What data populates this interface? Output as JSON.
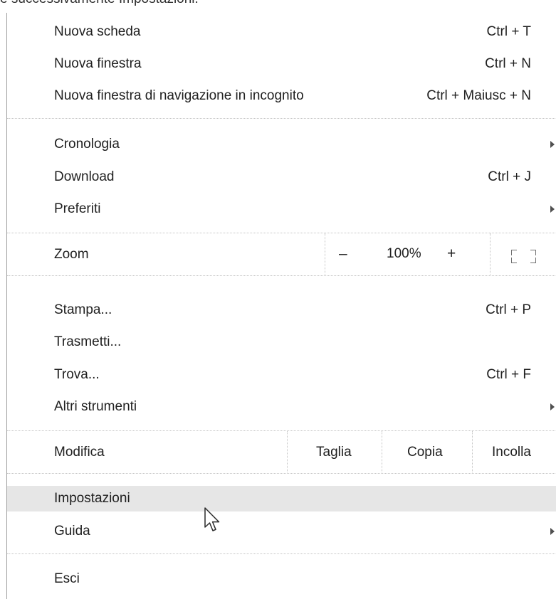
{
  "caption": "e successivamente Impostazioni:",
  "menu": {
    "new_tab": {
      "label": "Nuova scheda",
      "shortcut": "Ctrl + T"
    },
    "new_window": {
      "label": "Nuova finestra",
      "shortcut": "Ctrl + N"
    },
    "incognito": {
      "label": "Nuova finestra di navigazione in incognito",
      "shortcut": "Ctrl + Maiusc + N"
    },
    "history": {
      "label": "Cronologia"
    },
    "downloads": {
      "label": "Download",
      "shortcut": "Ctrl + J"
    },
    "bookmarks": {
      "label": "Preferiti"
    },
    "zoom": {
      "label": "Zoom",
      "minus": "–",
      "level": "100%",
      "plus": "+"
    },
    "print": {
      "label": "Stampa...",
      "shortcut": "Ctrl + P"
    },
    "cast": {
      "label": "Trasmetti..."
    },
    "find": {
      "label": "Trova...",
      "shortcut": "Ctrl + F"
    },
    "more_tools": {
      "label": "Altri strumenti"
    },
    "edit": {
      "label": "Modifica",
      "cut": "Taglia",
      "copy": "Copia",
      "paste": "Incolla"
    },
    "settings": {
      "label": "Impostazioni"
    },
    "help": {
      "label": "Guida"
    },
    "exit": {
      "label": "Esci"
    }
  },
  "icons": {
    "submenu": "triangle-right-icon",
    "fullscreen": "fullscreen-icon",
    "cursor": "mouse-pointer-icon"
  },
  "colors": {
    "hover": "#e6e6e6",
    "separator": "#c4c4c4"
  }
}
